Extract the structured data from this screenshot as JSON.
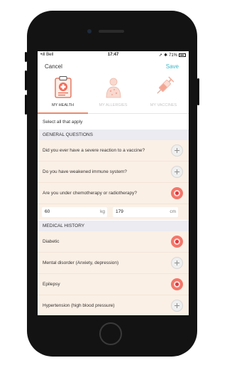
{
  "status": {
    "carrier": "•ıll Bell",
    "time": "17:47",
    "battery": "71%"
  },
  "nav": {
    "cancel": "Cancel",
    "save": "Save"
  },
  "tabs": [
    {
      "label": "MY HEALTH",
      "icon": "clipboard-medical-icon",
      "active": true
    },
    {
      "label": "MY ALLERGIES",
      "icon": "person-allergy-icon",
      "active": false
    },
    {
      "label": "MY VACCINES",
      "icon": "syringe-icon",
      "active": false
    }
  ],
  "hint": "Select all that apply",
  "sections": {
    "general": "GENERAL QUESTIONS",
    "history": "MEDICAL HISTORY"
  },
  "general_questions": [
    {
      "text": "Did you ever have a severe reaction to a vaccine?",
      "selected": false
    },
    {
      "text": "Do you have weakened immune system?",
      "selected": false
    },
    {
      "text": "Are you under chemotherapy or radiotherapy?",
      "selected": true
    }
  ],
  "measurements": {
    "weight": {
      "value": "60",
      "unit": "kg"
    },
    "height": {
      "value": "179",
      "unit": "cm"
    }
  },
  "medical_history": [
    {
      "text": "Diabetic",
      "selected": true
    },
    {
      "text": "Mental disorder (Anxiety, depression)",
      "selected": false
    },
    {
      "text": "Epilepsy",
      "selected": true
    },
    {
      "text": "Hypertension (high blood pressure)",
      "selected": false
    }
  ],
  "colors": {
    "accent": "#3bb6c8",
    "selected": "#f47669",
    "tab_underline": "#e98a6d",
    "row_bg": "#fbf0e6"
  }
}
